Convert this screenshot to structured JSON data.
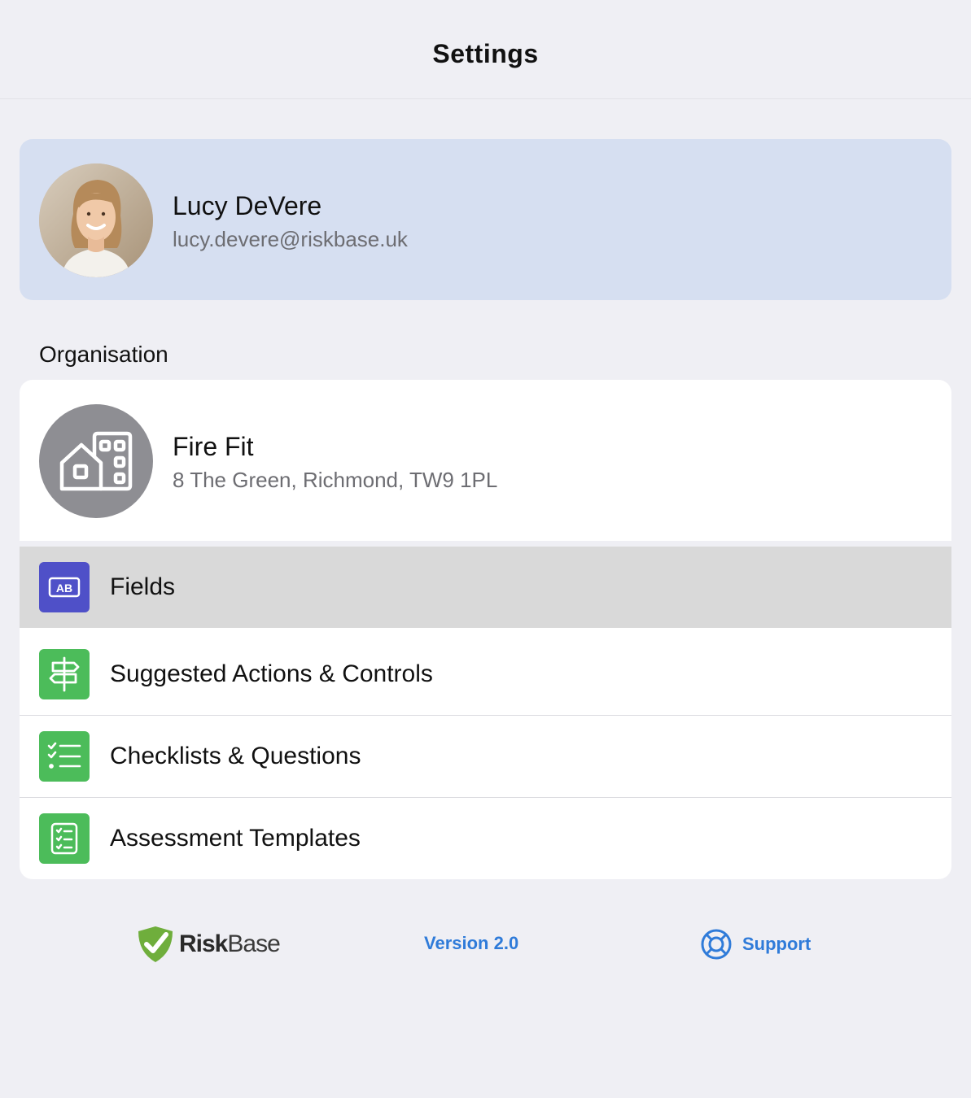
{
  "navbar": {
    "title": "Settings"
  },
  "profile": {
    "name": "Lucy DeVere",
    "email": "lucy.devere@riskbase.uk",
    "avatar_icon": "user-photo"
  },
  "organisation": {
    "section_title": "Organisation",
    "name": "Fire Fit",
    "address": "8 The Green, Richmond, TW9 1PL",
    "icon": "buildings-icon",
    "menu": [
      {
        "label": "Fields",
        "icon": "ab-field-icon",
        "icon_color": "#4f50c8",
        "selected": true
      },
      {
        "label": "Suggested Actions & Controls",
        "icon": "signpost-icon",
        "icon_color": "#4cbc5a",
        "selected": false
      },
      {
        "label": "Checklists & Questions",
        "icon": "checklist-icon",
        "icon_color": "#4cbc5a",
        "selected": false
      },
      {
        "label": "Assessment Templates",
        "icon": "template-icon",
        "icon_color": "#4cbc5a",
        "selected": false
      }
    ]
  },
  "footer": {
    "logo_text_bold": "Risk",
    "logo_text_regular": "Base",
    "version": "Version 2.0",
    "support": "Support",
    "accent_color": "#2f7bd9"
  }
}
